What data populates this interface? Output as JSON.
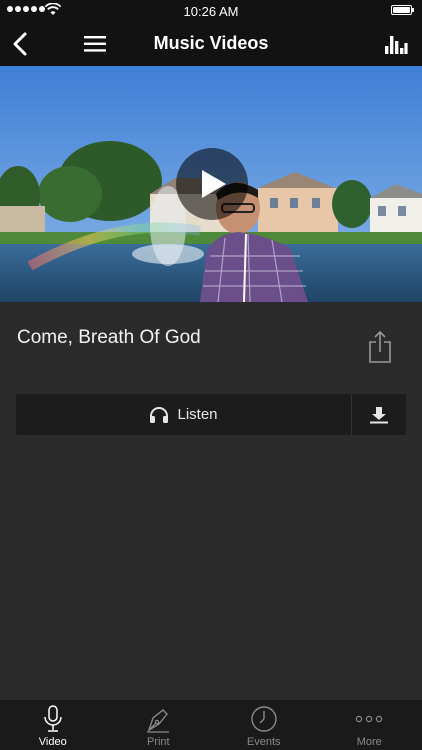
{
  "status_bar": {
    "time": "10:26 AM"
  },
  "nav": {
    "title": "Music Videos",
    "back_icon": "chevron-left-icon",
    "menu_icon": "hamburger-menu-icon",
    "stats_icon": "bar-chart-icon"
  },
  "video": {
    "play_icon": "play-icon"
  },
  "song": {
    "title": "Come, Breath Of God",
    "share_icon": "share-icon"
  },
  "actions": {
    "listen_label": "Listen",
    "listen_icon": "headphones-icon",
    "download_icon": "download-icon"
  },
  "tabs": [
    {
      "label": "Video",
      "icon": "microphone-icon",
      "active": true
    },
    {
      "label": "Print",
      "icon": "pen-nib-icon",
      "active": false
    },
    {
      "label": "Events",
      "icon": "clock-icon",
      "active": false
    },
    {
      "label": "More",
      "icon": "more-dots-icon",
      "active": false
    }
  ],
  "colors": {
    "bar_background": "#121212",
    "page_background": "#2b2b2b",
    "button_background": "#1c1c1c",
    "active_tab": "#ffffff",
    "inactive_tab": "#8a8a8a"
  }
}
